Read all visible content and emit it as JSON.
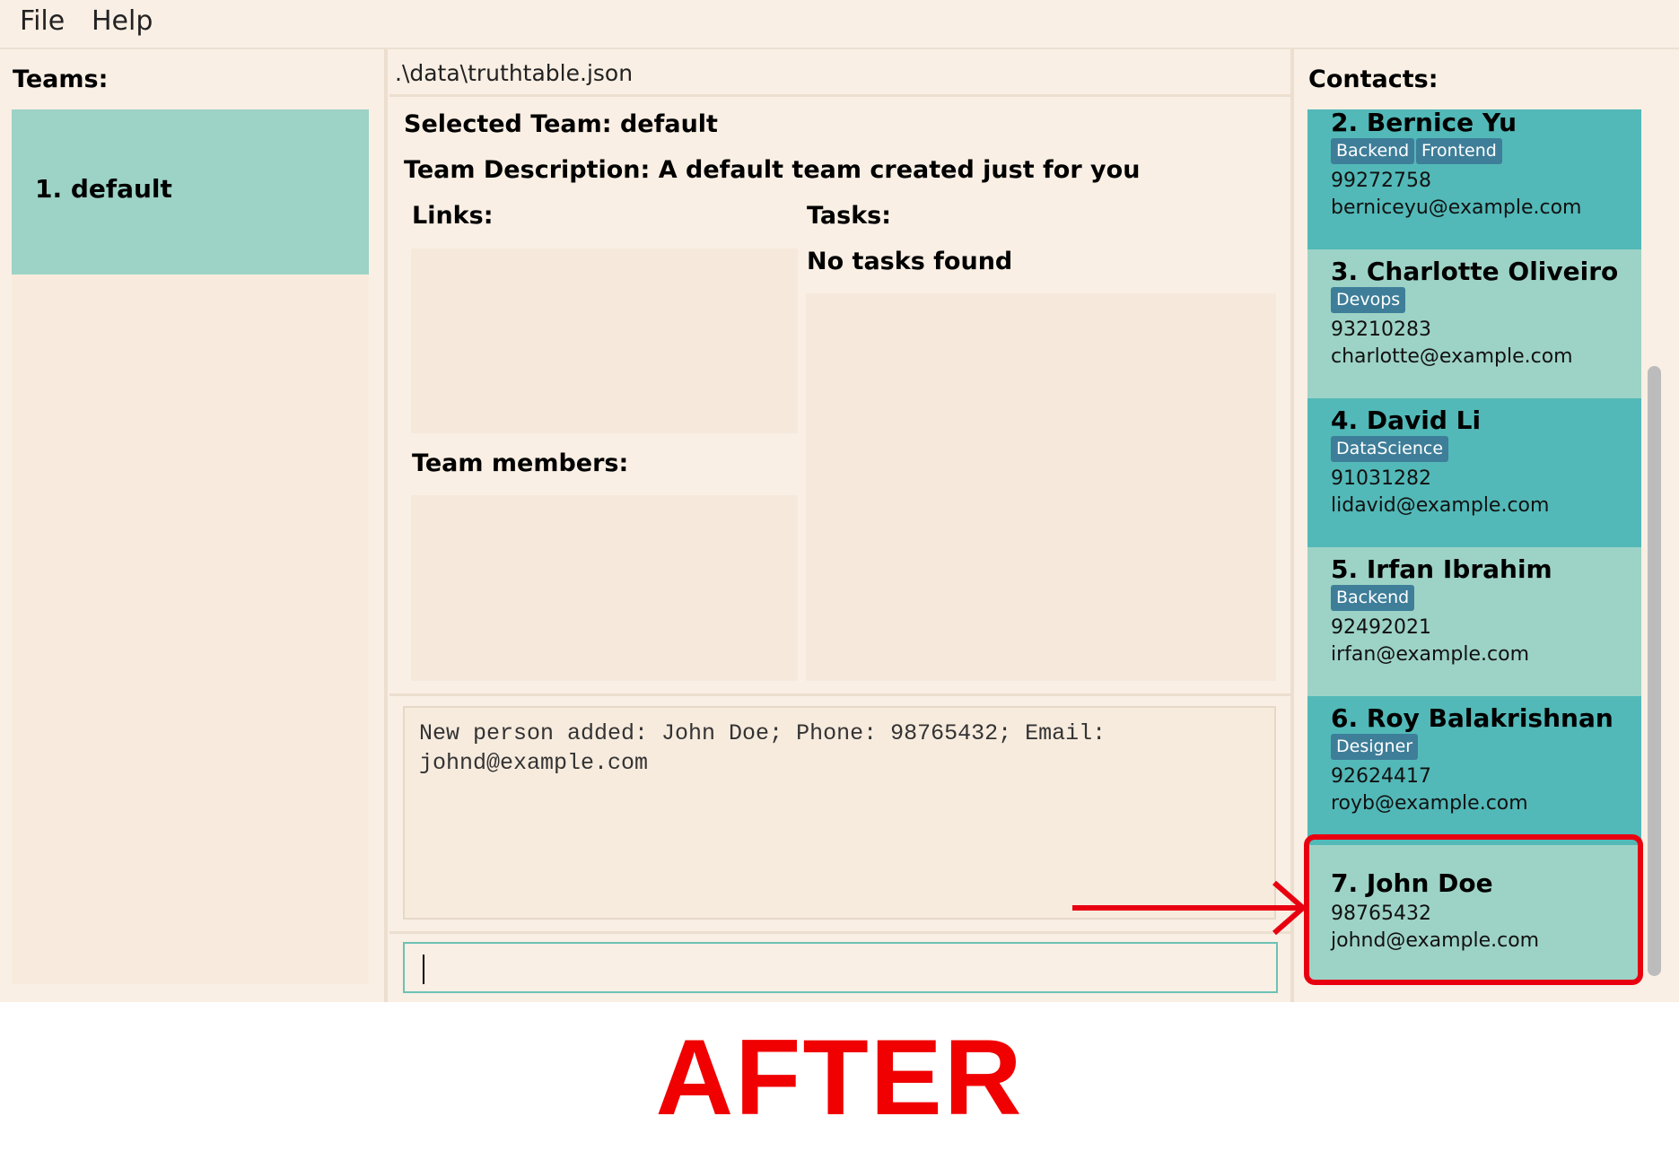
{
  "menu": {
    "file": "File",
    "help": "Help"
  },
  "teams": {
    "title": "Teams:",
    "items": [
      {
        "label": "1. default"
      }
    ]
  },
  "center": {
    "file_path": ".\\data\\truthtable.json",
    "selected_team": "Selected Team: default",
    "team_description": "Team Description: A default team created just for you",
    "links_label": "Links:",
    "tasks_label": "Tasks:",
    "no_tasks": "No tasks found",
    "members_label": "Team members:",
    "result_text": "New person added: John Doe; Phone: 98765432; Email: johnd@example.com",
    "command_value": ""
  },
  "contacts": {
    "title": "Contacts:",
    "items": [
      {
        "name": "2. Bernice Yu",
        "tags": [
          "Backend",
          "Frontend"
        ],
        "phone": "99272758",
        "email": "berniceyu@example.com"
      },
      {
        "name": "3. Charlotte Oliveiro",
        "tags": [
          "Devops"
        ],
        "phone": "93210283",
        "email": "charlotte@example.com"
      },
      {
        "name": "4. David Li",
        "tags": [
          "DataScience"
        ],
        "phone": "91031282",
        "email": "lidavid@example.com"
      },
      {
        "name": "5. Irfan Ibrahim",
        "tags": [
          "Backend"
        ],
        "phone": "92492021",
        "email": "irfan@example.com"
      },
      {
        "name": "6. Roy Balakrishnan",
        "tags": [
          "Designer"
        ],
        "phone": "92624417",
        "email": "royb@example.com"
      },
      {
        "name": "7. John Doe",
        "tags": [],
        "phone": "98765432",
        "email": "johnd@example.com"
      }
    ]
  },
  "annotation": {
    "label": "AFTER",
    "color": "#f00000"
  },
  "colors": {
    "background": "#f9efe4",
    "card_dark": "#52b9b8",
    "card_light": "#9dd3c6",
    "tag": "#3e7e99",
    "highlight": "#e80010"
  }
}
